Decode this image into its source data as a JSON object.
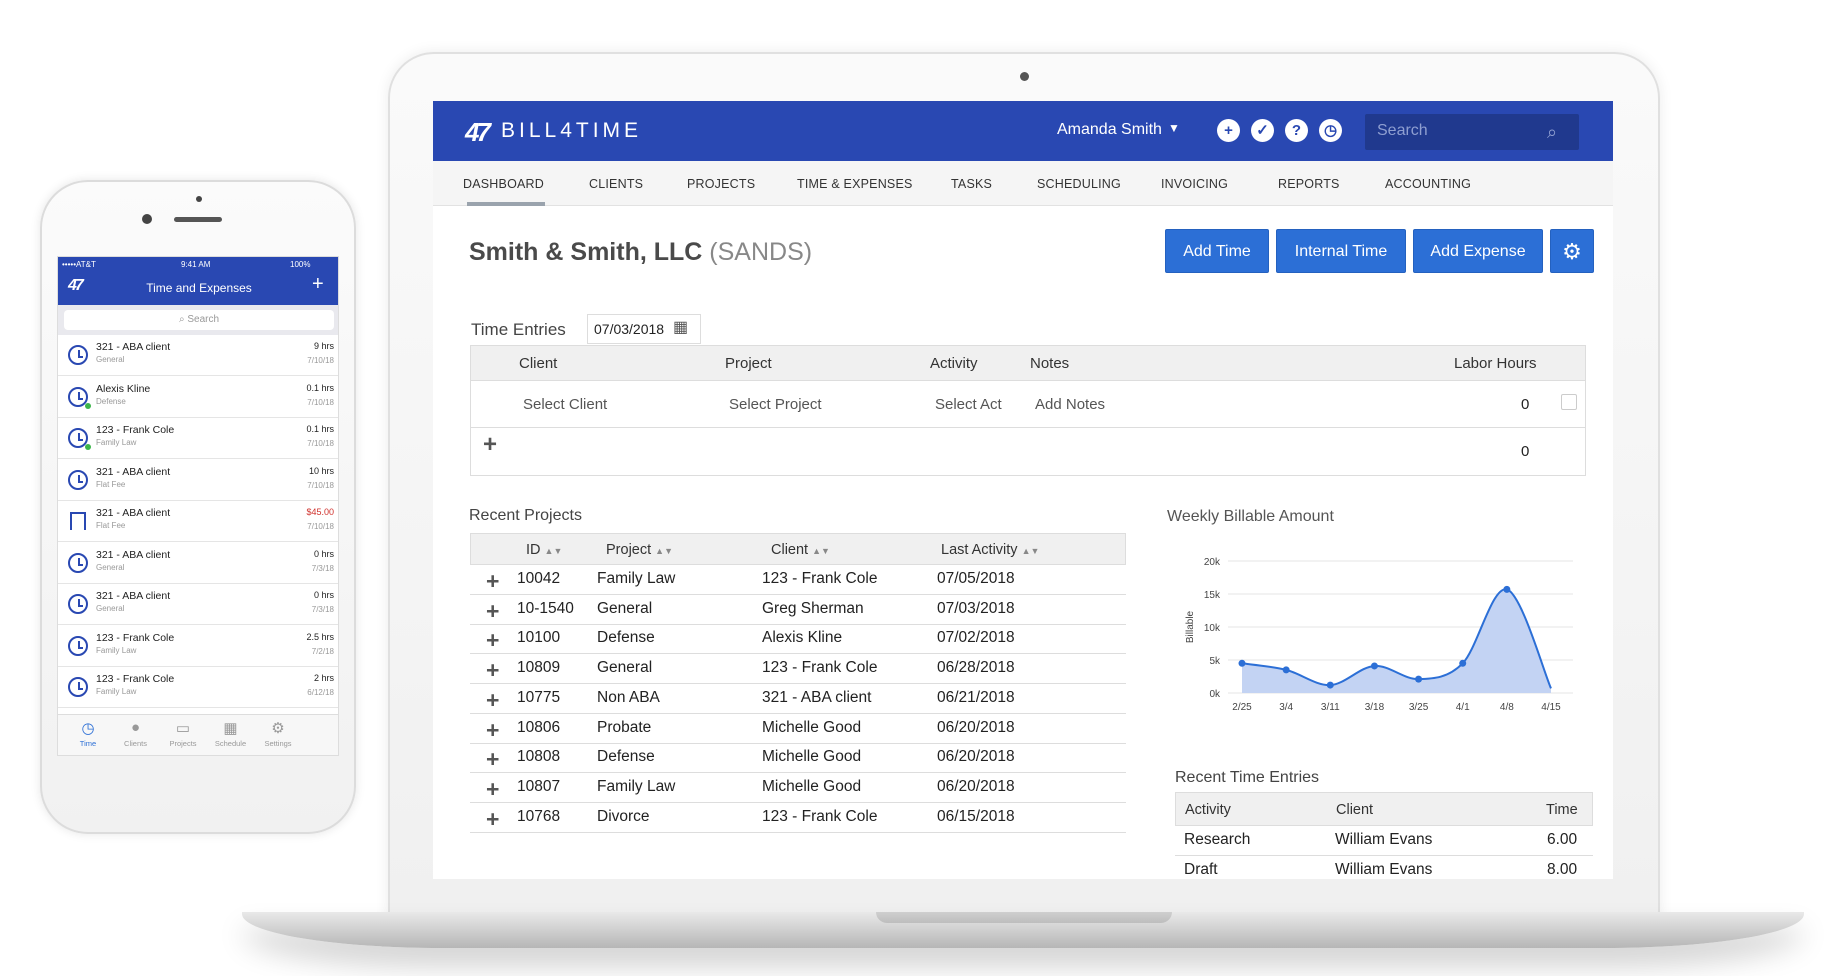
{
  "app": {
    "logo_mark": "47",
    "logo_text": "BILL4TIME",
    "user_name": "Amanda Smith",
    "search_placeholder": "Search",
    "brand_color": "#2948b2",
    "button_color": "#2c6fd6"
  },
  "nav": [
    "DASHBOARD",
    "CLIENTS",
    "PROJECTS",
    "TIME & EXPENSES",
    "TASKS",
    "SCHEDULING",
    "INVOICING",
    "REPORTS",
    "ACCOUNTING"
  ],
  "page": {
    "title": "Smith & Smith, LLC",
    "code": "(SANDS)",
    "buttons": [
      "Add Time",
      "Internal Time",
      "Add Expense"
    ]
  },
  "time_entries": {
    "label": "Time Entries",
    "date": "07/03/2018",
    "headers": [
      "Client",
      "Project",
      "Activity",
      "Notes",
      "Labor Hours"
    ],
    "row": {
      "client": "Select Client",
      "project": "Select Project",
      "activity": "Select Act",
      "notes": "Add Notes",
      "hours": "0"
    },
    "total": "0"
  },
  "recent_projects": {
    "label": "Recent Projects",
    "headers": [
      "ID",
      "Project",
      "Client",
      "Last Activity"
    ],
    "rows": [
      {
        "id": "10042",
        "project": "Family Law",
        "client": "123 - Frank Cole",
        "date": "07/05/2018"
      },
      {
        "id": "10-1540",
        "project": "General",
        "client": "Greg Sherman",
        "date": "07/03/2018"
      },
      {
        "id": "10100",
        "project": "Defense",
        "client": "Alexis Kline",
        "date": "07/02/2018"
      },
      {
        "id": "10809",
        "project": "General",
        "client": "123 - Frank Cole",
        "date": "06/28/2018"
      },
      {
        "id": "10775",
        "project": "Non ABA",
        "client": "321 - ABA client",
        "date": "06/21/2018"
      },
      {
        "id": "10806",
        "project": "Probate",
        "client": "Michelle Good",
        "date": "06/20/2018"
      },
      {
        "id": "10808",
        "project": "Defense",
        "client": "Michelle Good",
        "date": "06/20/2018"
      },
      {
        "id": "10807",
        "project": "Family Law",
        "client": "Michelle Good",
        "date": "06/20/2018"
      },
      {
        "id": "10768",
        "project": "Divorce",
        "client": "123 - Frank Cole",
        "date": "06/15/2018"
      }
    ]
  },
  "chart_data": {
    "type": "area",
    "title": "Weekly Billable Amount",
    "xlabel": "",
    "ylabel": "Billable",
    "categories": [
      "2/25",
      "3/4",
      "3/11",
      "3/18",
      "3/25",
      "4/1",
      "4/8",
      "4/15"
    ],
    "values": [
      4500,
      3500,
      1200,
      4100,
      2100,
      4500,
      15700,
      700
    ],
    "y_ticks": [
      "0k",
      "5k",
      "10k",
      "15k",
      "20k"
    ],
    "ylim": [
      0,
      20000
    ],
    "grid": true,
    "fill_color": "#c3d3f3",
    "line_color": "#2c6fd6"
  },
  "recent_time_entries": {
    "label": "Recent Time Entries",
    "headers": [
      "Activity",
      "Client",
      "Time"
    ],
    "rows": [
      {
        "activity": "Research",
        "client": "William Evans",
        "time": "6.00"
      },
      {
        "activity": "Draft",
        "client": "William Evans",
        "time": "8.00"
      }
    ]
  },
  "phone": {
    "status_left": "•••••AT&T",
    "status_time": "9:41 AM",
    "status_battery": "100%",
    "title": "Time and Expenses",
    "search_placeholder": "Search",
    "items": [
      {
        "name": "321 - ABA client",
        "sub": "General",
        "value": "9 hrs",
        "date": "7/10/18",
        "icon": "clock",
        "dot": false
      },
      {
        "name": "Alexis Kline",
        "sub": "Defense",
        "value": "0.1 hrs",
        "date": "7/10/18",
        "icon": "clock",
        "dot": true
      },
      {
        "name": "123 - Frank Cole",
        "sub": "Family Law",
        "value": "0.1 hrs",
        "date": "7/10/18",
        "icon": "clock",
        "dot": true
      },
      {
        "name": "321 - ABA client",
        "sub": "Flat Fee",
        "value": "10 hrs",
        "date": "7/10/18",
        "icon": "clock",
        "dot": false
      },
      {
        "name": "321 - ABA client",
        "sub": "Flat Fee",
        "value": "$45.00",
        "date": "7/10/18",
        "icon": "expense",
        "dot": false
      },
      {
        "name": "321 - ABA client",
        "sub": "General",
        "value": "0 hrs",
        "date": "7/3/18",
        "icon": "clock",
        "dot": false
      },
      {
        "name": "321 - ABA client",
        "sub": "General",
        "value": "0 hrs",
        "date": "7/3/18",
        "icon": "clock",
        "dot": false
      },
      {
        "name": "123 - Frank Cole",
        "sub": "Family Law",
        "value": "2.5 hrs",
        "date": "7/2/18",
        "icon": "clock",
        "dot": false
      },
      {
        "name": "123 - Frank Cole",
        "sub": "Family Law",
        "value": "2 hrs",
        "date": "6/12/18",
        "icon": "clock",
        "dot": false
      }
    ],
    "tabs": [
      "Time",
      "Clients",
      "Projects",
      "Schedule",
      "Settings"
    ]
  }
}
